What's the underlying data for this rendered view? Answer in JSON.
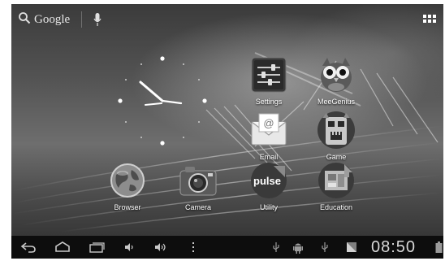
{
  "search": {
    "label": "Google"
  },
  "apps": [
    {
      "label": "Settings",
      "icon": "settings-icon"
    },
    {
      "label": "MeeGenius",
      "icon": "owl-icon"
    },
    {
      "label": "Email",
      "icon": "email-icon"
    },
    {
      "label": "Game",
      "icon": "game-mask-icon"
    },
    {
      "label": "Browser",
      "icon": "globe-icon"
    },
    {
      "label": "Camera",
      "icon": "camera-icon"
    },
    {
      "label": "Utility",
      "icon": "pulse-icon",
      "badge": "pulse"
    },
    {
      "label": "Education",
      "icon": "education-icon"
    }
  ],
  "status": {
    "time": "08:50"
  },
  "nav": [
    "back-icon",
    "home-icon",
    "recent-apps-icon",
    "volume-down-icon",
    "volume-up-icon",
    "menu-icon"
  ],
  "colors": {
    "nav_bar": "#0d0d0d",
    "label": "#ffffff"
  }
}
